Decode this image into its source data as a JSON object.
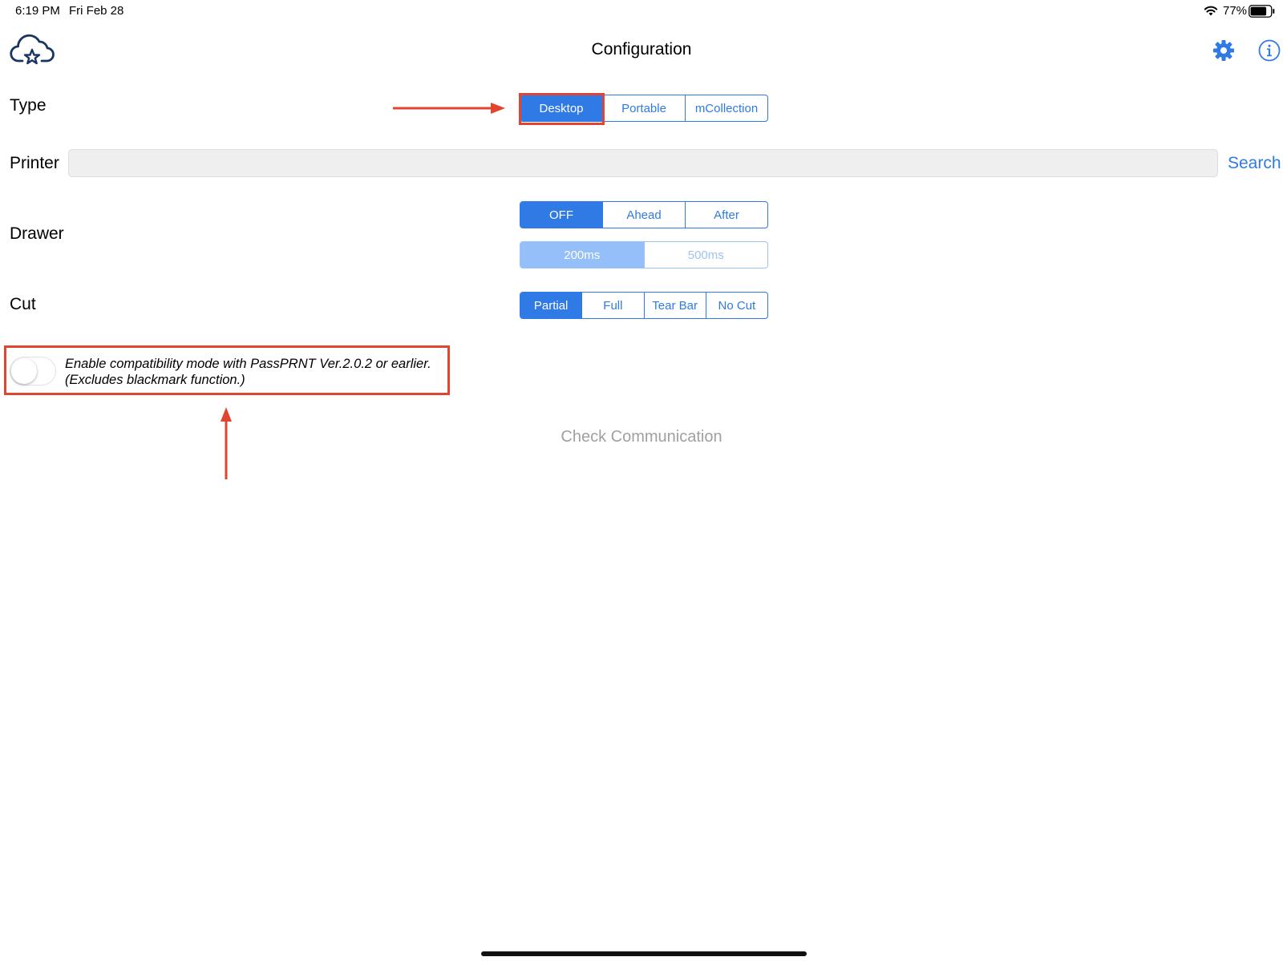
{
  "status_bar": {
    "time": "6:19 PM",
    "date": "Fri Feb 28",
    "battery": "77%"
  },
  "header": {
    "title": "Configuration"
  },
  "type_row": {
    "label": "Type",
    "options": [
      "Desktop",
      "Portable",
      "mCollection"
    ],
    "selected": "Desktop"
  },
  "printer_row": {
    "label": "Printer",
    "value": "",
    "search_label": "Search"
  },
  "drawer_row": {
    "label": "Drawer",
    "options": [
      "OFF",
      "Ahead",
      "After"
    ],
    "selected": "OFF",
    "delay_options": [
      "200ms",
      "500ms"
    ],
    "delay_selected": "200ms"
  },
  "cut_row": {
    "label": "Cut",
    "options": [
      "Partial",
      "Full",
      "Tear Bar",
      "No Cut"
    ],
    "selected": "Partial"
  },
  "compat": {
    "line1": "Enable compatibility mode with PassPRNT Ver.2.0.2 or earlier.",
    "line2": "(Excludes blackmark function.)",
    "enabled": false
  },
  "check_communication": "Check Communication",
  "colors": {
    "accent": "#2f7ae5",
    "annotation": "#e1452f",
    "disabled_text": "#a0a0a0"
  }
}
